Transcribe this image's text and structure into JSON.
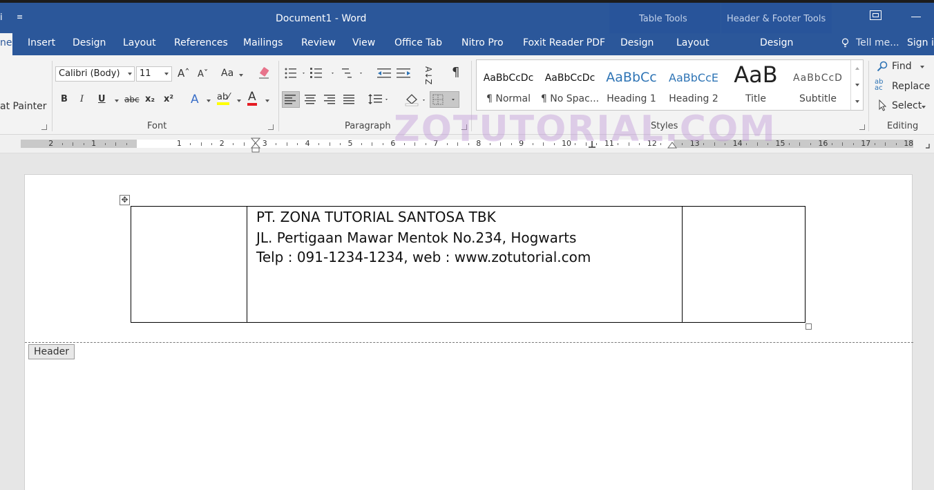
{
  "titlebar": {
    "qat_left": "i",
    "qat_dropdown": "≡",
    "document_title": "Document1 - Word",
    "context_table_tools": "Table Tools",
    "context_header_footer_tools": "Header & Footer Tools"
  },
  "tabs": {
    "home": "ne",
    "insert": "Insert",
    "design": "Design",
    "layout": "Layout",
    "references": "References",
    "mailings": "Mailings",
    "review": "Review",
    "view": "View",
    "office_tab": "Office Tab",
    "nitro_pro": "Nitro Pro",
    "foxit": "Foxit Reader PDF",
    "table_design": "Design",
    "table_layout": "Layout",
    "hf_design": "Design",
    "tell_me": "Tell me...",
    "sign_in": "Sign in"
  },
  "clipboard": {
    "format_painter": "at Painter"
  },
  "font": {
    "font_name": "Calibri (Body)",
    "font_size": "11",
    "grow": "Aˆ",
    "shrink": "Aˇ",
    "change_case": "Aa",
    "bold": "B",
    "italic": "I",
    "underline": "U",
    "strikethrough": "abc",
    "subscript": "x₂",
    "superscript": "x²",
    "text_effects": "A",
    "highlight": "ab⁄",
    "font_color": "A",
    "label": "Font"
  },
  "paragraph": {
    "pilcrow": "¶",
    "sort": "A↓Z",
    "label": "Paragraph"
  },
  "styles": {
    "items": [
      {
        "preview": "AaBbCcDc",
        "name": "¶ Normal"
      },
      {
        "preview": "AaBbCcDc",
        "name": "¶ No Spac..."
      },
      {
        "preview": "AaBbCc",
        "name": "Heading 1"
      },
      {
        "preview": "AaBbCcE",
        "name": "Heading 2"
      },
      {
        "preview": "AaB",
        "name": "Title"
      },
      {
        "preview": "AaBbCcD",
        "name": "Subtitle"
      }
    ],
    "label": "Styles",
    "heading_color": "#2e74b5"
  },
  "editing": {
    "find": "Find",
    "replace": "Replace",
    "select": "Select",
    "label": "Editing"
  },
  "ruler": {
    "numbers": [
      "2",
      "1",
      "1",
      "2",
      "3",
      "4",
      "5",
      "6",
      "7",
      "8",
      "9",
      "10",
      "11",
      "12",
      "13",
      "14",
      "15",
      "16",
      "17",
      "18"
    ]
  },
  "watermark": "ZOTUTORIAL.COM",
  "document": {
    "header_lines": [
      "PT. ZONA TUTORIAL SANTOSA TBK",
      "JL. Pertigaan Mawar Mentok No.234, Hogwarts",
      "Telp : 091-1234-1234, web : www.zotutorial.com"
    ],
    "header_tag": "Header"
  },
  "colors": {
    "word_blue": "#2b579a",
    "ribbon_bg": "#f3f3f3",
    "context_tab_bg": "#28549a"
  }
}
